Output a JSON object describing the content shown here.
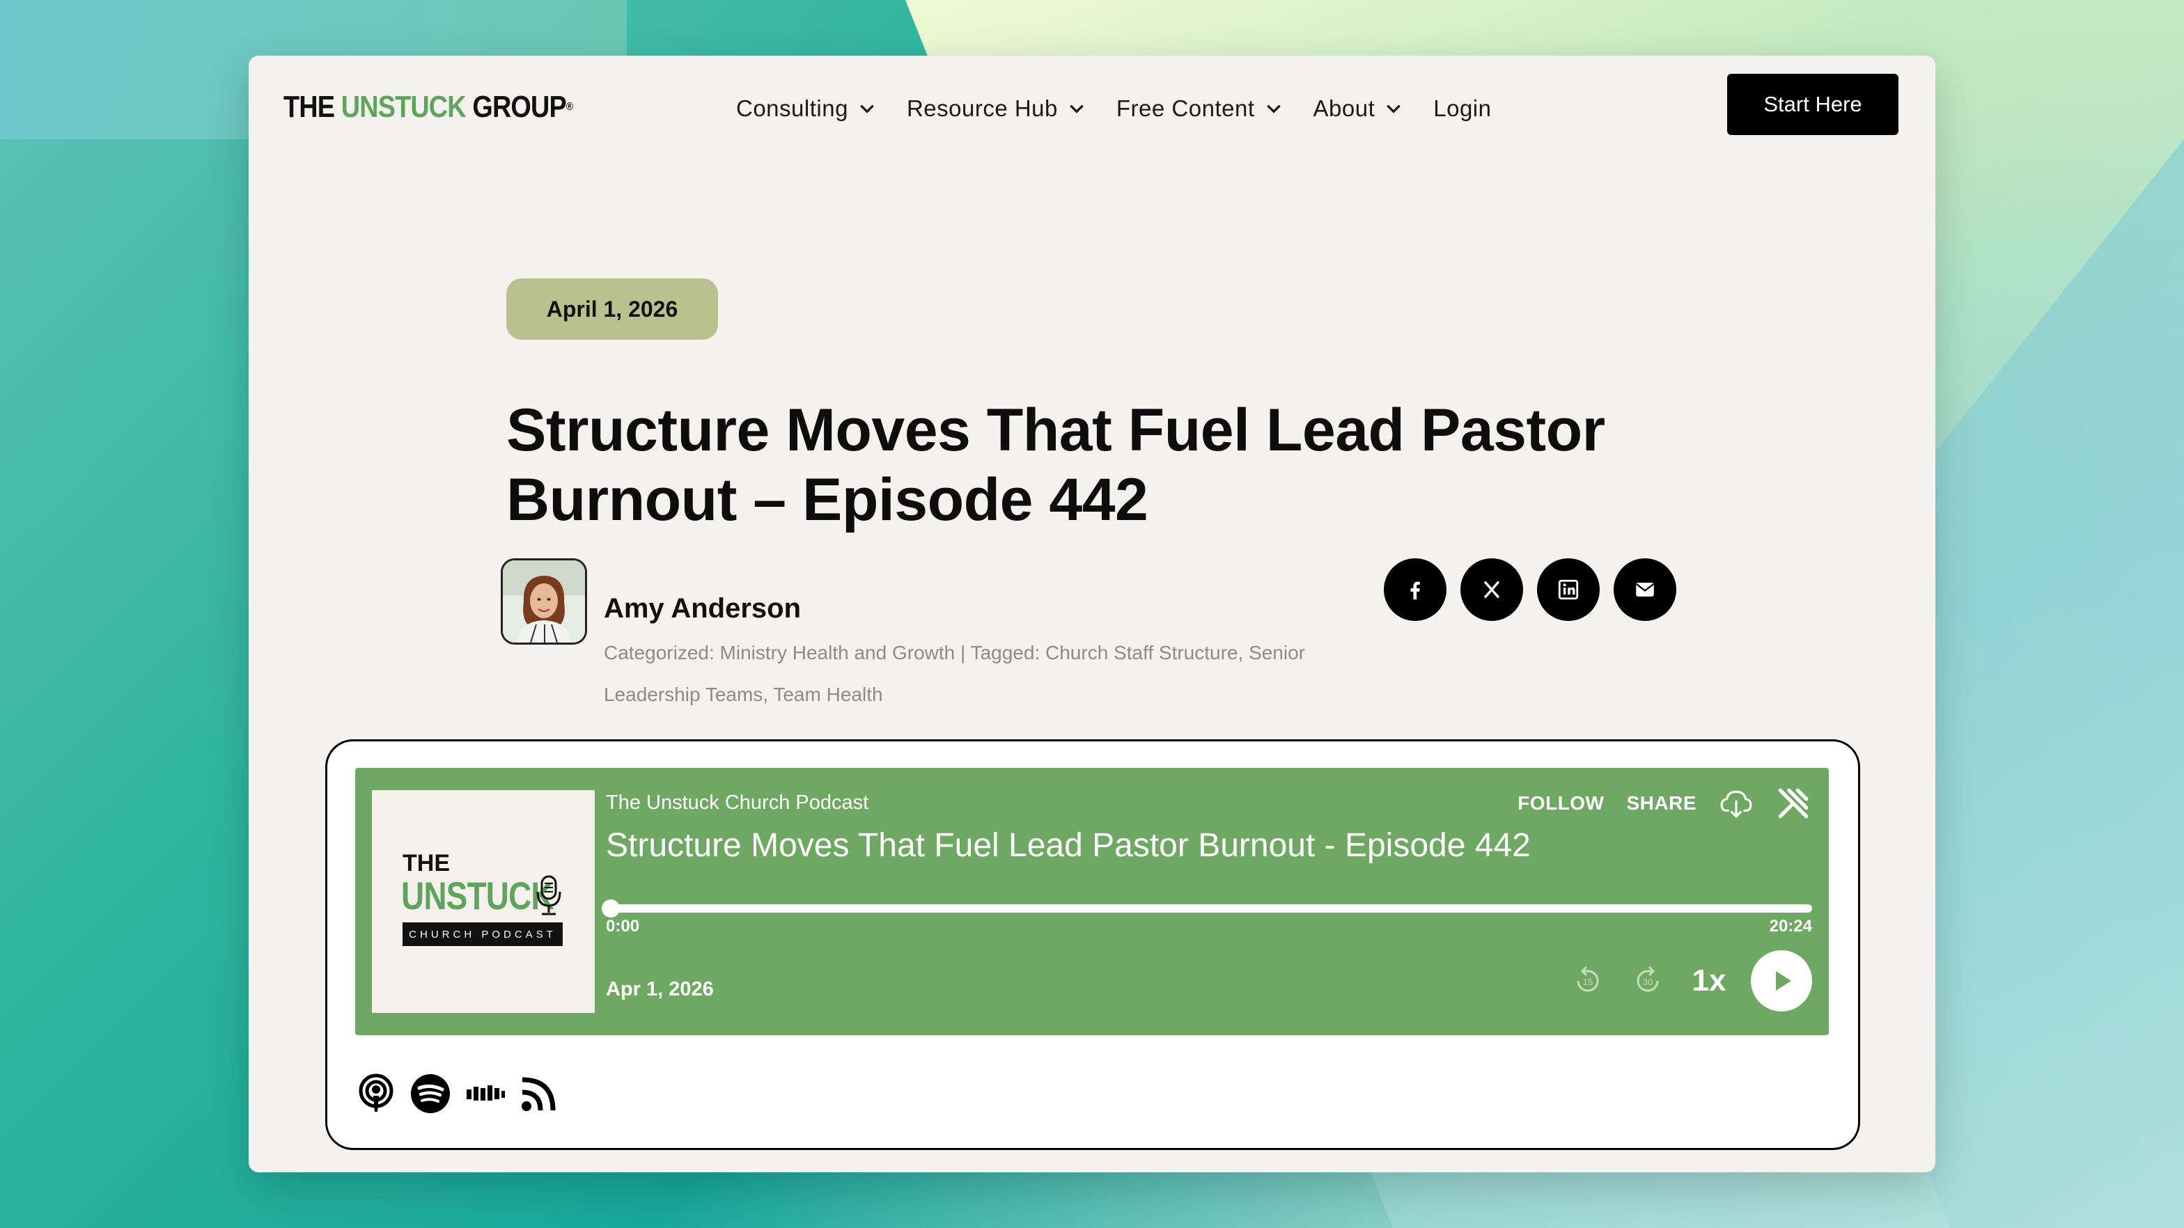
{
  "header": {
    "logo": {
      "part1": "THE ",
      "part2": "UNSTUCK",
      "part3": " GROUP",
      "mark": "®"
    },
    "nav": [
      {
        "label": "Consulting",
        "has_dropdown": true
      },
      {
        "label": "Resource Hub",
        "has_dropdown": true
      },
      {
        "label": "Free Content",
        "has_dropdown": true
      },
      {
        "label": "About",
        "has_dropdown": true
      },
      {
        "label": "Login",
        "has_dropdown": false
      }
    ],
    "cta_label": "Start Here"
  },
  "article": {
    "date": "April 1, 2026",
    "title": "Structure Moves That Fuel Lead Pastor Burnout – Episode 442",
    "author": {
      "name": "Amy Anderson",
      "categorized_label": "Categorized:",
      "category": "Ministry Health and Growth",
      "separator": "|",
      "tagged_label": "Tagged:",
      "tags": [
        "Church Staff Structure",
        "Senior Leadership Teams",
        "Team Health"
      ]
    },
    "share_icons": [
      "facebook-icon",
      "x-twitter-icon",
      "linkedin-icon",
      "email-icon"
    ]
  },
  "player": {
    "cover": {
      "the": "THE",
      "unstuck": "UNSTUCK",
      "subtitle": "CHURCH PODCAST"
    },
    "podcast_name": "The Unstuck Church Podcast",
    "episode_title": "Structure Moves That Fuel Lead Pastor Burnout - Episode 442",
    "follow_label": "FOLLOW",
    "share_label": "SHARE",
    "time_current": "0:00",
    "time_total": "20:24",
    "progress_fraction": 0.0,
    "published": "Apr 1, 2026",
    "skip_back": "15",
    "skip_forward": "30",
    "speed": "1x",
    "platforms": [
      "apple-podcasts-icon",
      "spotify-icon",
      "castbox-icon",
      "rss-icon"
    ],
    "colors": {
      "player_bg": "#6ea862",
      "badge_bg": "#b9c28f",
      "brand_green": "#5fa35c"
    }
  }
}
